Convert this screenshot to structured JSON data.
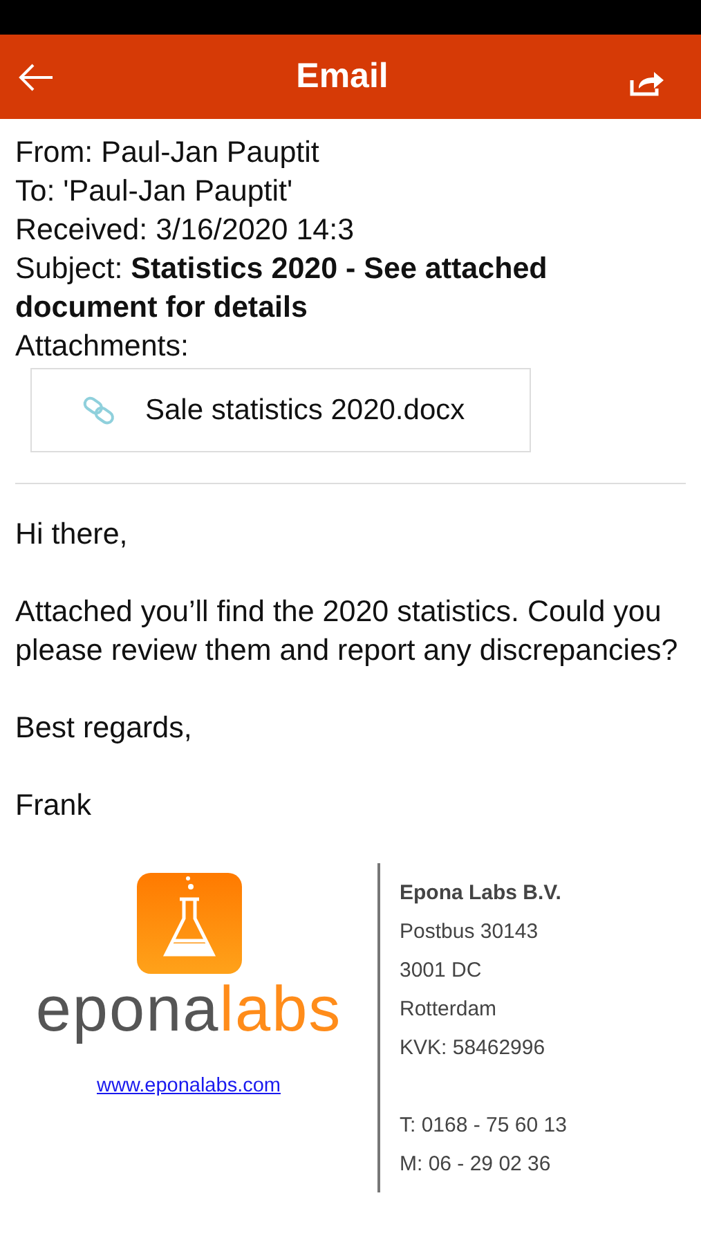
{
  "header": {
    "title": "Email"
  },
  "meta": {
    "from": "From: Paul-Jan Pauptit",
    "to": "To: 'Paul-Jan Pauptit'",
    "received": "Received: 3/16/2020 14:3",
    "subject_label": "Subject: ",
    "subject": "Statistics 2020 - See attached document for details",
    "attachments_label": "Attachments:"
  },
  "attachments": [
    {
      "name": "Sale statistics 2020.docx"
    }
  ],
  "body": [
    "Hi there,",
    "Attached you’ll find the 2020 statistics. Could you please review them and report any discrepancies?",
    "Best regards,",
    "Frank"
  ],
  "signature": {
    "logo_prefix": "epona",
    "logo_suffix": "labs",
    "website": "www.eponalabs.com",
    "company": "Epona Labs B.V.",
    "address": [
      "Postbus 30143",
      "3001 DC",
      "Rotterdam",
      "KVK: 58462996"
    ],
    "phones": [
      "T: 0168 - 75 60 13",
      "M: 06 - 29 02 36"
    ]
  }
}
